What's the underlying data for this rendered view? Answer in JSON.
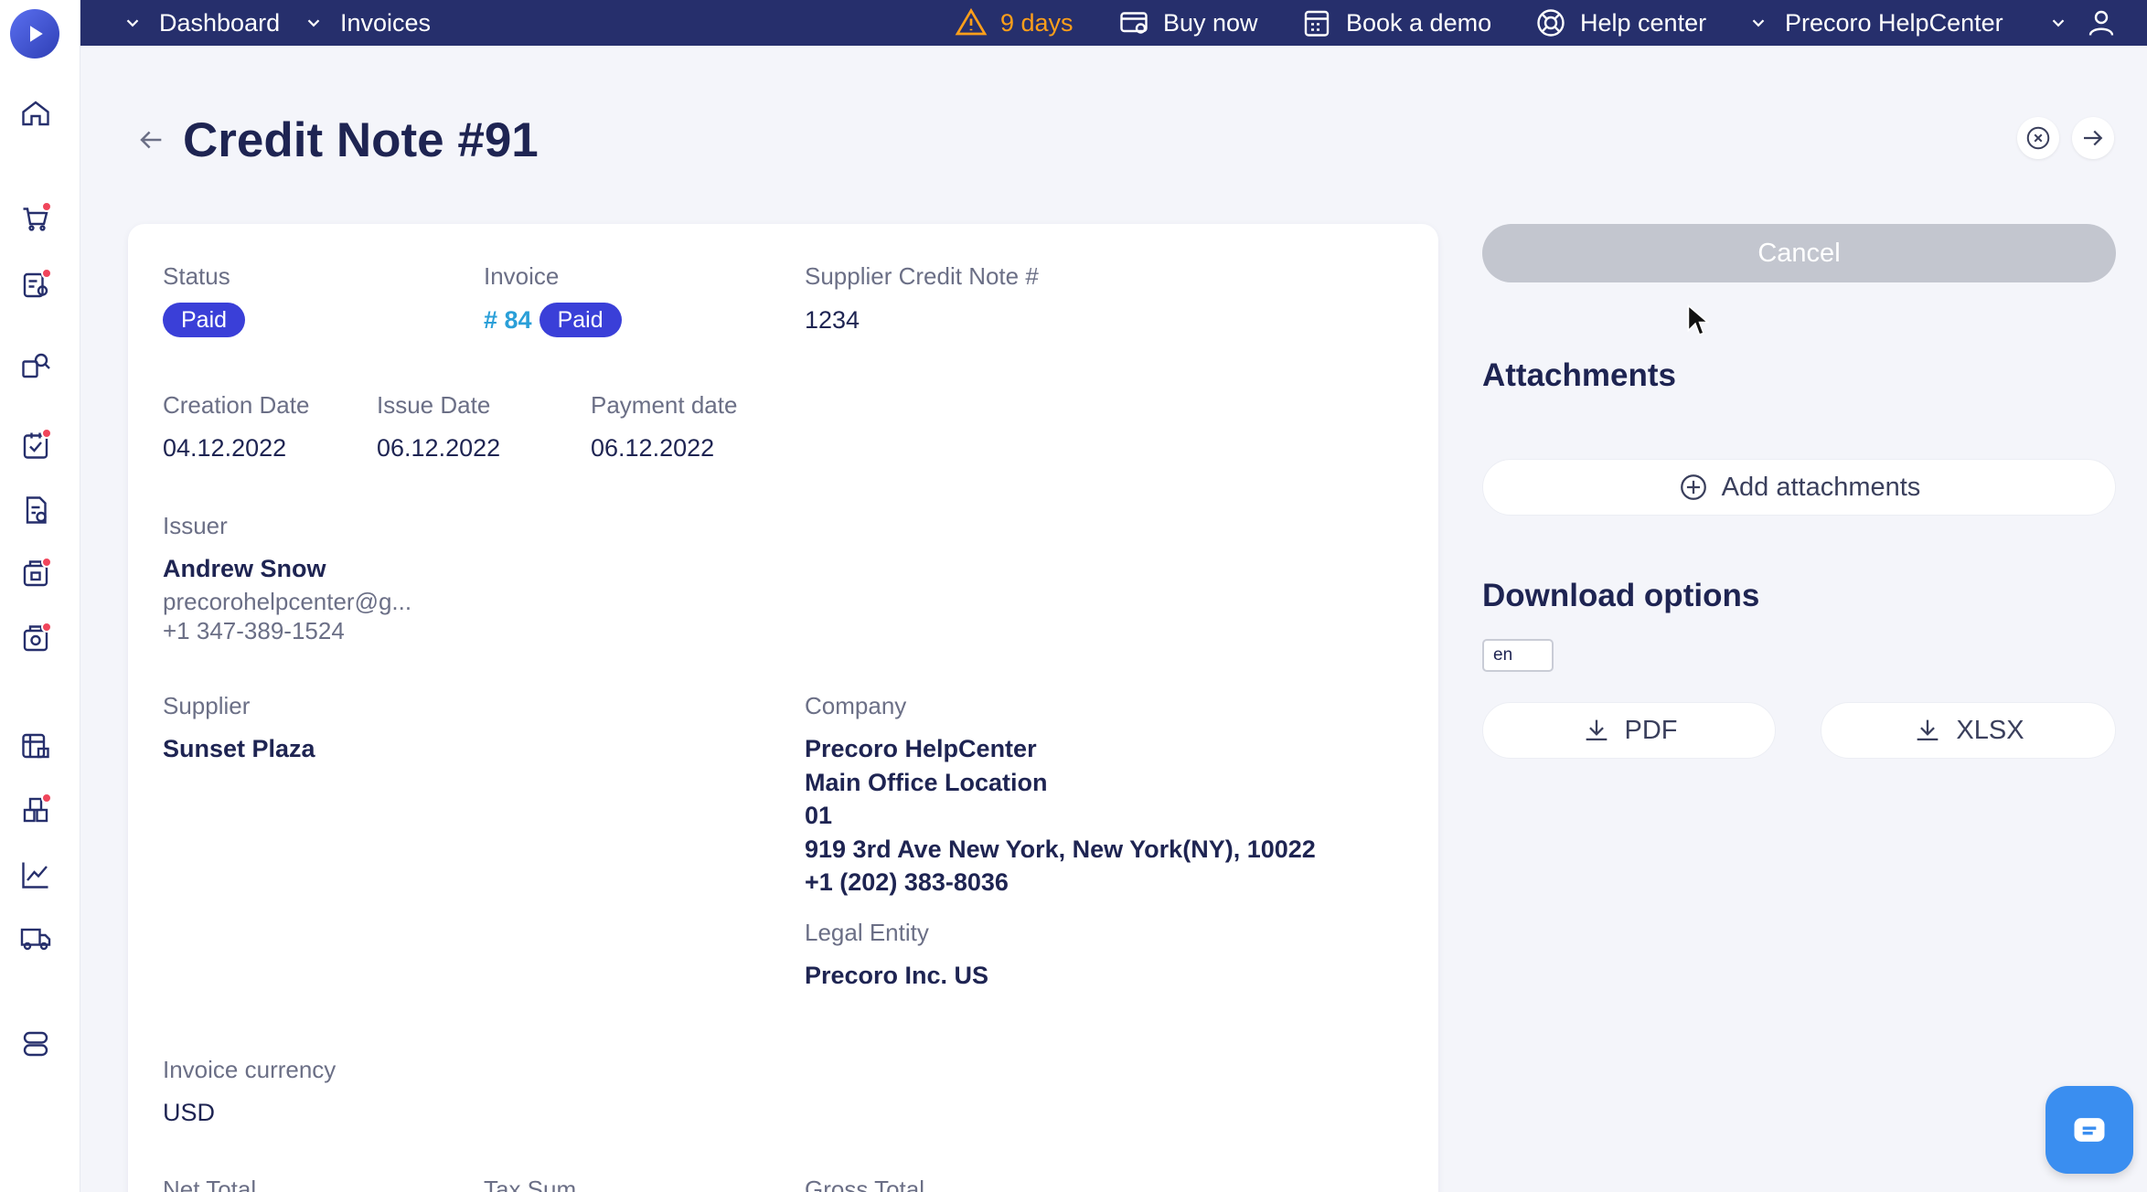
{
  "topbar": {
    "dashboard": "Dashboard",
    "invoices": "Invoices",
    "trial_days": "9 days",
    "buy_now": "Buy now",
    "book_demo": "Book a demo",
    "help_center": "Help center",
    "company": "Precoro HelpCenter"
  },
  "page": {
    "title": "Credit Note #91"
  },
  "details": {
    "status_label": "Status",
    "status_value": "Paid",
    "invoice_label": "Invoice",
    "invoice_link": "# 84",
    "invoice_status": "Paid",
    "supplier_cn_label": "Supplier Credit Note #",
    "supplier_cn_value": "1234",
    "creation_date_label": "Creation Date",
    "creation_date_value": "04.12.2022",
    "issue_date_label": "Issue Date",
    "issue_date_value": "06.12.2022",
    "payment_date_label": "Payment date",
    "payment_date_value": "06.12.2022",
    "issuer_label": "Issuer",
    "issuer_name": "Andrew Snow",
    "issuer_email": "precorohelpcenter@g...",
    "issuer_phone": "+1 347-389-1524",
    "supplier_label": "Supplier",
    "supplier_value": "Sunset Plaza",
    "company_label": "Company",
    "company_lines": [
      "Precoro HelpCenter",
      "Main Office Location",
      "01",
      "919 3rd Ave New York, New York(NY), 10022",
      "+1 (202) 383-8036"
    ],
    "legal_entity_label": "Legal Entity",
    "legal_entity_value": "Precoro Inc. US",
    "currency_label": "Invoice currency",
    "currency_value": "USD",
    "net_total_label": "Net Total",
    "tax_sum_label": "Tax Sum",
    "gross_total_label": "Gross Total"
  },
  "actions": {
    "cancel": "Cancel",
    "attachments_title": "Attachments",
    "add_attachments": "Add attachments",
    "download_title": "Download options",
    "language": "en",
    "pdf": "PDF",
    "xlsx": "XLSX"
  },
  "colors": {
    "topbar": "#262f6c",
    "badge": "#3a3fd8",
    "link": "#2a9fd8",
    "warning": "#ff9f1a",
    "chat": "#3a8ef0"
  }
}
